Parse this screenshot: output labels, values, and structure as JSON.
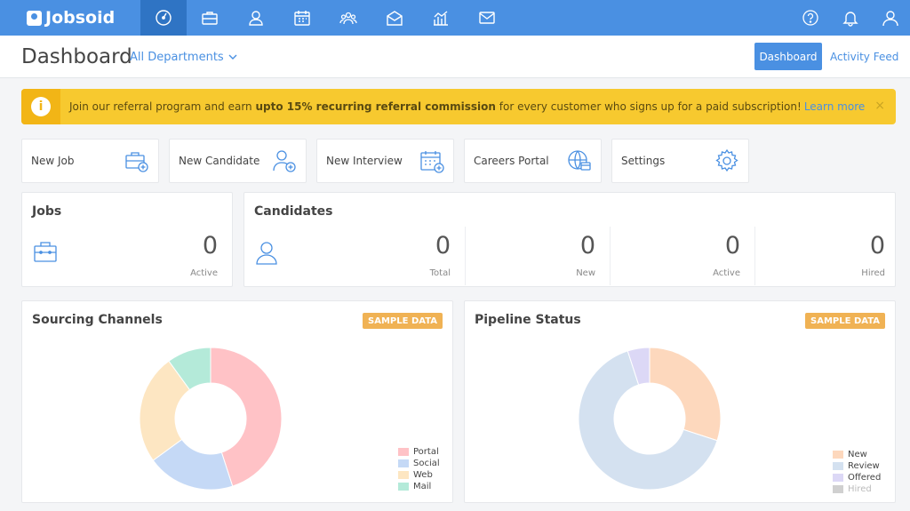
{
  "app": {
    "logo_text": "Jobsoid"
  },
  "nav": {
    "icons": [
      "dashboard-icon",
      "briefcase-icon",
      "user-icon",
      "calendar-icon",
      "team-icon",
      "mail-open-icon",
      "chart-icon",
      "envelope-icon"
    ],
    "right_icons": [
      "help-icon",
      "bell-icon",
      "profile-icon"
    ]
  },
  "header": {
    "title": "Dashboard",
    "department": "All Departments",
    "dashboard_button": "Dashboard",
    "activity_feed": "Activity Feed"
  },
  "banner": {
    "text_before": "Join our referral program and earn ",
    "text_bold": "upto 15% recurring referral commission",
    "text_after": " for every customer who signs up for a paid subscription!",
    "link": "Learn more",
    "close": "×"
  },
  "quick_actions": [
    {
      "label": "New Job",
      "icon": "briefcase-add-icon"
    },
    {
      "label": "New Candidate",
      "icon": "user-add-icon"
    },
    {
      "label": "New Interview",
      "icon": "calendar-add-icon"
    },
    {
      "label": "Careers Portal",
      "icon": "globe-icon"
    },
    {
      "label": "Settings",
      "icon": "gear-icon"
    }
  ],
  "jobs": {
    "title": "Jobs",
    "value": "0",
    "label": "Active"
  },
  "candidates": {
    "title": "Candidates",
    "stats": [
      {
        "value": "0",
        "label": "Total"
      },
      {
        "value": "0",
        "label": "New"
      },
      {
        "value": "0",
        "label": "Active"
      },
      {
        "value": "0",
        "label": "Hired"
      }
    ]
  },
  "sample_badge": "SAMPLE DATA",
  "colors": {
    "primary": "#4a90e2",
    "portal": "#ffc2c6",
    "social": "#c5d9f6",
    "web": "#fde6c2",
    "mail": "#b4ead9",
    "new": "#fdd8bd",
    "review": "#d4e1f0",
    "offered": "#dcd8f6",
    "hired": "#d0d0d0"
  },
  "chart_data": [
    {
      "type": "pie",
      "title": "Sourcing Channels",
      "categories": [
        "Portal",
        "Social",
        "Web",
        "Mail"
      ],
      "values": [
        45,
        20,
        25,
        10
      ]
    },
    {
      "type": "pie",
      "title": "Pipeline Status",
      "categories": [
        "New",
        "Review",
        "Offered",
        "Hired"
      ],
      "values": [
        30,
        65,
        5,
        0
      ]
    }
  ]
}
